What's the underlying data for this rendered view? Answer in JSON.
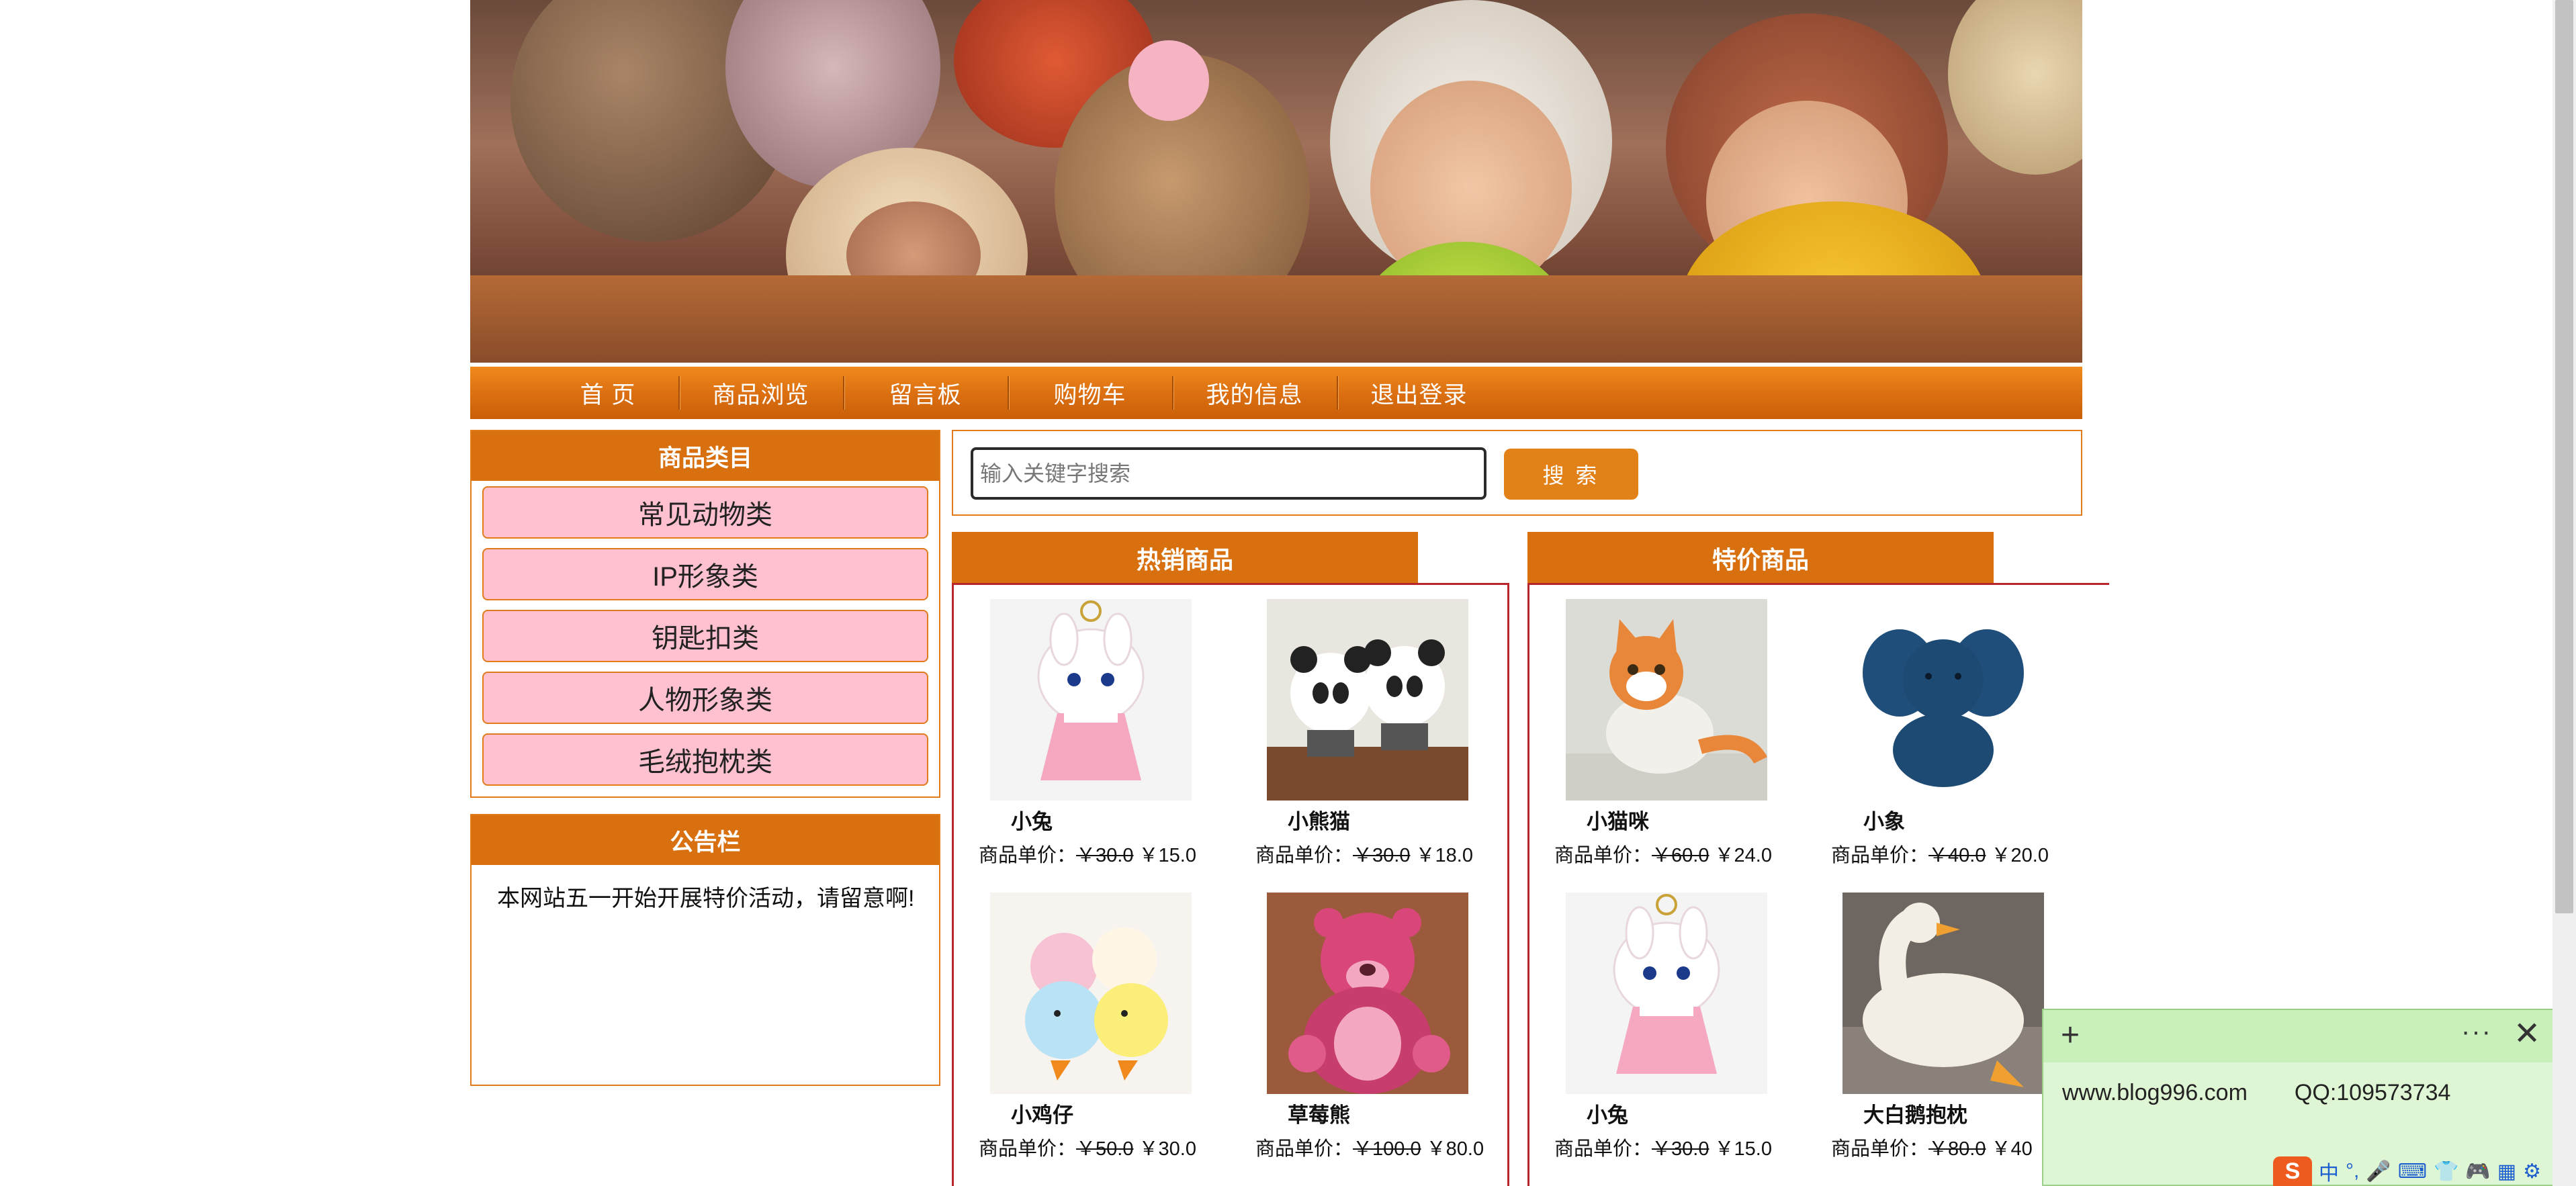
{
  "nav": {
    "items": [
      "首 页",
      "商品浏览",
      "留言板",
      "购物车",
      "我的信息",
      "退出登录"
    ]
  },
  "categories": {
    "title": "商品类目",
    "items": [
      "常见动物类",
      "IP形象类",
      "钥匙扣类",
      "人物形象类",
      "毛绒抱枕类"
    ]
  },
  "notice": {
    "title": "公告栏",
    "text": "本网站五一开始开展特价活动，请留意啊!"
  },
  "search": {
    "placeholder": "输入关键字搜索",
    "button": "搜 索"
  },
  "hot": {
    "title": "热销商品",
    "products": [
      {
        "name": "小兔",
        "price_label": "商品单价：",
        "old_price": "￥30.0",
        "new_price": "￥15.0"
      },
      {
        "name": "小熊猫",
        "price_label": "商品单价：",
        "old_price": "￥30.0",
        "new_price": "￥18.0"
      },
      {
        "name": "小鸡仔",
        "price_label": "商品单价：",
        "old_price": "￥50.0",
        "new_price": "￥30.0"
      },
      {
        "name": "草莓熊",
        "price_label": "商品单价：",
        "old_price": "￥100.0",
        "new_price": "￥80.0"
      }
    ]
  },
  "special": {
    "title": "特价商品",
    "products": [
      {
        "name": "小猫咪",
        "price_label": "商品单价：",
        "old_price": "￥60.0",
        "new_price": "￥24.0"
      },
      {
        "name": "小象",
        "price_label": "商品单价：",
        "old_price": "￥40.0",
        "new_price": "￥20.0"
      },
      {
        "name": "小兔",
        "price_label": "商品单价：",
        "old_price": "￥30.0",
        "new_price": "￥15.0"
      },
      {
        "name": "大白鹅抱枕",
        "price_label": "商品单价：",
        "old_price": "￥80.0",
        "new_price": "￥40"
      }
    ]
  },
  "note": {
    "plus": "+",
    "more": "···",
    "close": "✕",
    "site": "www.blog996.com",
    "qq": "QQ:109573734"
  },
  "ime": {
    "logo": "S",
    "items": [
      "中",
      "°,",
      "🎤",
      "⌨",
      "👕",
      "🎮",
      "▦",
      "⚙"
    ]
  },
  "colors": {
    "accent_orange": "#d8700f",
    "category_pink": "#ffc1cf",
    "section_border_red": "#b7262b",
    "note_green": "#dff6d4"
  }
}
